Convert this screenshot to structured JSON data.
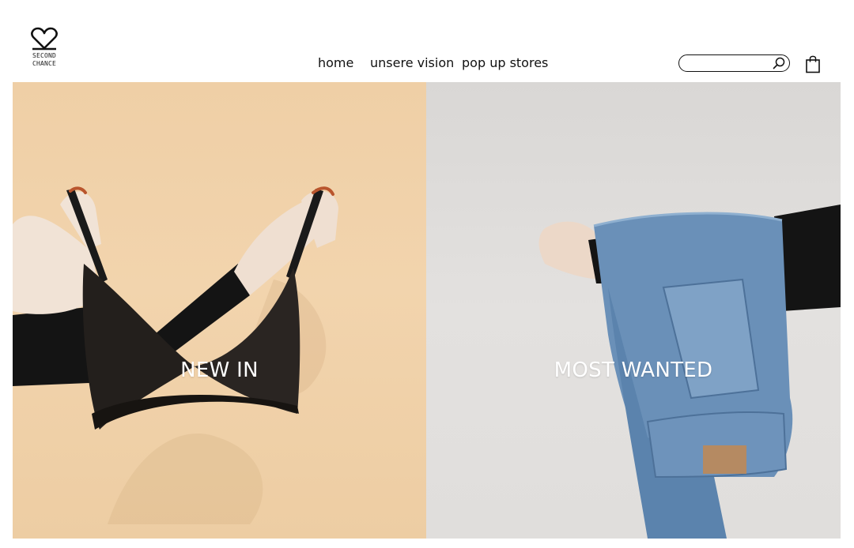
{
  "brand": {
    "logo_line1": "SECOND",
    "logo_line2": "CHANCE",
    "logo_icon": "heart-icon"
  },
  "nav": {
    "items": [
      "home",
      "unsere vision",
      "pop up stores"
    ]
  },
  "search": {
    "placeholder": "",
    "value": "",
    "icon": "search-icon"
  },
  "cart": {
    "icon": "shopping-bag-icon"
  },
  "tiles": [
    {
      "label": "NEW IN",
      "bg": "#efcfa6"
    },
    {
      "label": "MOST WANTED",
      "bg": "#dedcda"
    }
  ]
}
